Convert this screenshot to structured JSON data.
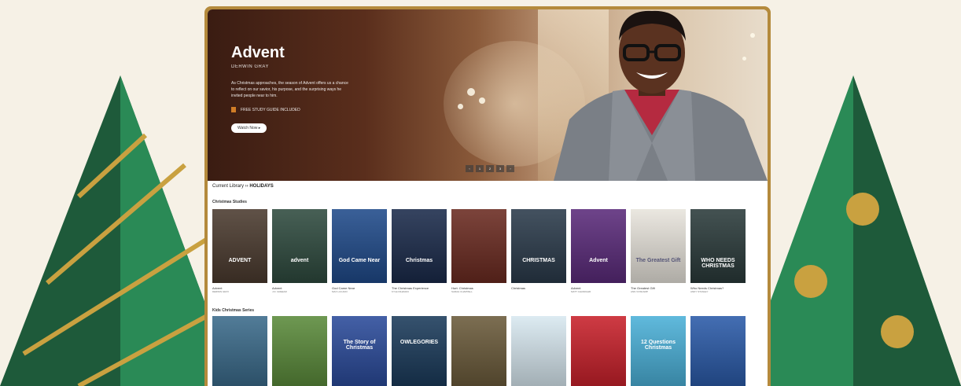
{
  "colors": {
    "background": "#f6f1e6",
    "frame_gold": "#b48a3c",
    "tree_dark": "#1e5a3a",
    "tree_light": "#2a8a56",
    "ornament_gold": "#c9a140"
  },
  "hero": {
    "title": "Advent",
    "author": "DERWIN GRAY",
    "description": "As Christmas approaches, the season of Advent offers us a chance to reflect on our savior, his purpose, and the surprising ways he invited people near to him.",
    "guide_label": "FREE STUDY GUIDE INCLUDED",
    "watch_label": "Watch Now ▸",
    "pager": [
      "‹",
      "1",
      "2",
      "3",
      "›"
    ]
  },
  "breadcrumb": {
    "prefix": "Current Library ›› ",
    "current": "HOLIDAYS"
  },
  "rows": [
    {
      "title": "Christmas Studies",
      "items": [
        {
          "title": "Advent",
          "author": "DERWIN GRAY",
          "cover_text": "ADVENT",
          "bg": "#4a3a2e"
        },
        {
          "title": "Advent",
          "author": "J.D. GREEAR",
          "cover_text": "advent",
          "bg": "#2e4a3e"
        },
        {
          "title": "God Came Near",
          "author": "MAX LUCADO",
          "cover_text": "God Came Near",
          "bg": "#1f4a8a"
        },
        {
          "title": "The Christmas Experience",
          "author": "KYLE IDLEMAN",
          "cover_text": "Christmas",
          "bg": "#1a2a4a"
        },
        {
          "title": "Hurt: Christmas",
          "author": "SARAH CHAPPELL",
          "cover_text": "",
          "bg": "#6a2a20"
        },
        {
          "title": "Christmas",
          "author": "",
          "cover_text": "CHRISTMAS",
          "bg": "#2a3a4a"
        },
        {
          "title": "Advent",
          "author": "MATT CHANDLER",
          "cover_text": "Advent",
          "bg": "#5a2a7a"
        },
        {
          "title": "The Greatest Gift",
          "author": "ANN VOSKAMP",
          "cover_text": "The Greatest Gift",
          "bg": "#e8e4dc"
        },
        {
          "title": "Who Needs Christmas?",
          "author": "ANDY STANLEY",
          "cover_text": "WHO NEEDS CHRISTMAS",
          "bg": "#2a3a3a"
        }
      ]
    },
    {
      "title": "Kids Christmas Series",
      "items": [
        {
          "title": "",
          "author": "",
          "cover_text": "",
          "bg": "#3a6a8a"
        },
        {
          "title": "",
          "author": "",
          "cover_text": "",
          "bg": "#5a8a3a"
        },
        {
          "title": "",
          "author": "",
          "cover_text": "The Story of Christmas",
          "bg": "#2a4a9a"
        },
        {
          "title": "",
          "author": "",
          "cover_text": "OWLEGORIES",
          "bg": "#1a3a5a"
        },
        {
          "title": "",
          "author": "",
          "cover_text": "",
          "bg": "#6a5a3a"
        },
        {
          "title": "",
          "author": "",
          "cover_text": "",
          "bg": "#d8e8f0"
        },
        {
          "title": "",
          "author": "",
          "cover_text": "",
          "bg": "#c8202a"
        },
        {
          "title": "",
          "author": "",
          "cover_text": "12 Questions Christmas",
          "bg": "#4ab0d8"
        },
        {
          "title": "",
          "author": "",
          "cover_text": "",
          "bg": "#2a5aa8"
        }
      ]
    }
  ]
}
